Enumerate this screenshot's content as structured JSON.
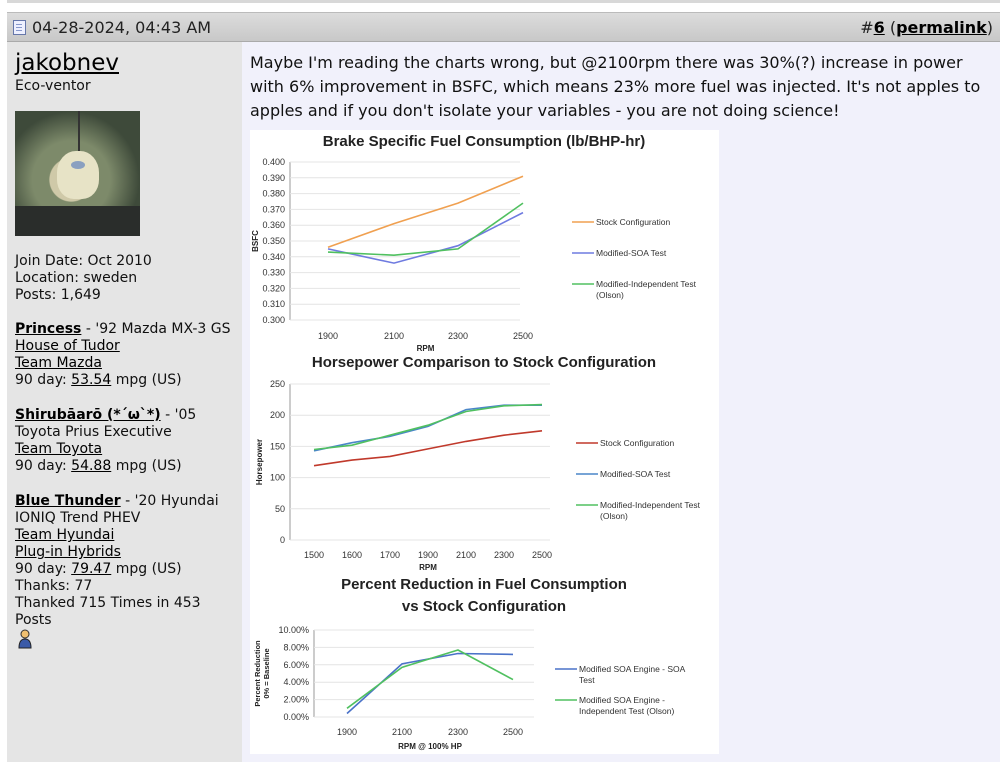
{
  "post": {
    "date": "04-28-2024, 04:43 AM",
    "number_prefix": "#",
    "number": "6",
    "permalink_label": "permalink"
  },
  "user": {
    "name": "jakobnev",
    "title": "Eco-ventor",
    "join_date": "Join Date: Oct 2010",
    "location": "Location: sweden",
    "posts": "Posts: 1,649",
    "cars": [
      {
        "name": "Princess",
        "desc": " - '92 Mazda MX-3 GS",
        "line2": "House of Tudor",
        "team": "Team Mazda",
        "mpg_prefix": "90 day: ",
        "mpg": "53.54",
        "mpg_suffix": " mpg (US)"
      },
      {
        "name": "Shirubāarō (*´ω`*)",
        "desc": " - '05",
        "line2": "Toyota Prius Executive",
        "team": "Team Toyota",
        "mpg_prefix": "90 day: ",
        "mpg": "54.88",
        "mpg_suffix": " mpg (US)"
      },
      {
        "name": "Blue Thunder",
        "desc": " - '20 Hyundai",
        "line2": "IONIQ Trend PHEV",
        "team": "Team Hyundai",
        "team2": "Plug-in Hybrids",
        "mpg_prefix": "90 day: ",
        "mpg": "79.47",
        "mpg_suffix": " mpg (US)"
      }
    ],
    "thanks": "Thanks: 77",
    "thanked": "Thanked 715 Times in 453 Posts",
    "status_icon": "user-online-icon"
  },
  "message": "Maybe I'm reading the charts wrong, but @2100rpm there was 30%(?) increase in power with 6% improvement in BSFC, which means 23% more fuel was injected. It's not apples to apples and if you don't isolate your variables - you are not doing science!",
  "chart_data": [
    {
      "type": "line",
      "title": "Brake Specific Fuel Consumption (lb/BHP-hr)",
      "xlabel": "RPM",
      "ylabel": "BSFC",
      "x": [
        1900,
        2100,
        2300,
        2500
      ],
      "ylim": [
        0.3,
        0.4
      ],
      "yticks": [
        "0.400",
        "0.390",
        "0.380",
        "0.370",
        "0.360",
        "0.350",
        "0.340",
        "0.330",
        "0.320",
        "0.310",
        "0.300"
      ],
      "series": [
        {
          "name": "Stock Configuration",
          "color": "#f0a050",
          "values": [
            0.346,
            0.361,
            0.374,
            0.391
          ]
        },
        {
          "name": "Modified-SOA Test",
          "color": "#6f7be0",
          "values": [
            0.345,
            0.336,
            0.347,
            0.368
          ]
        },
        {
          "name": "Modified-Independent Test (Olson)",
          "color": "#50c060",
          "values": [
            0.343,
            0.341,
            0.345,
            0.374
          ]
        }
      ]
    },
    {
      "type": "line",
      "title": "Horsepower Comparison to Stock Configuration",
      "xlabel": "RPM",
      "ylabel": "Horsepower",
      "x": [
        1500,
        1600,
        1700,
        1900,
        2100,
        2300,
        2500
      ],
      "ylim": [
        0,
        250
      ],
      "yticks": [
        "250",
        "200",
        "150",
        "100",
        "50",
        "0"
      ],
      "series": [
        {
          "name": "Stock Configuration",
          "color": "#c0392b",
          "values": [
            119,
            128,
            134,
            146,
            158,
            168,
            175
          ]
        },
        {
          "name": "Modified-SOA Test",
          "color": "#4a86c8",
          "values": [
            143,
            156,
            166,
            182,
            209,
            216,
            216
          ]
        },
        {
          "name": "Modified-Independent Test (Olson)",
          "color": "#50c060",
          "values": [
            145,
            152,
            168,
            184,
            206,
            215,
            217
          ]
        }
      ]
    },
    {
      "type": "line",
      "title": "Percent Reduction in Fuel Consumption",
      "subtitle": "vs Stock Configuration",
      "xlabel": "RPM @ 100% HP",
      "ylabel": "Percent Reduction 0% = Baseline",
      "x": [
        1900,
        2100,
        2300,
        2500
      ],
      "ylim": [
        0,
        10
      ],
      "yticks": [
        "10.00%",
        "8.00%",
        "6.00%",
        "4.00%",
        "2.00%",
        "0.00%"
      ],
      "series": [
        {
          "name": "Modified SOA Engine - SOA Test",
          "color": "#4a72c8",
          "values": [
            0.4,
            6.1,
            7.3,
            7.2
          ]
        },
        {
          "name": "Modified SOA Engine - Independent Test (Olson)",
          "color": "#50c060",
          "values": [
            1.0,
            5.7,
            7.7,
            4.3
          ]
        }
      ]
    }
  ]
}
